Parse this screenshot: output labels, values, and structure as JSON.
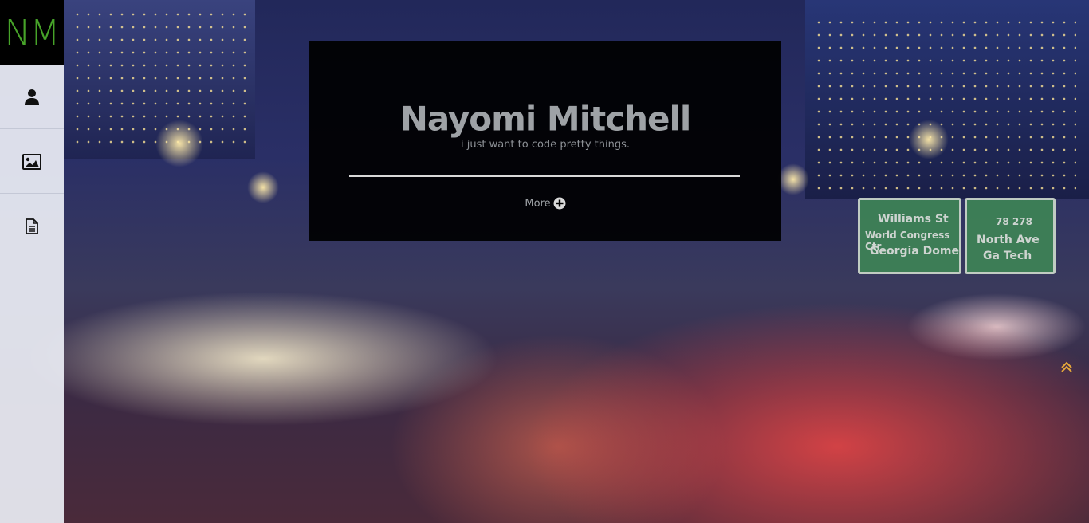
{
  "brand": {
    "logo_text": "NM",
    "accent_color": "#47a329"
  },
  "sidebar": {
    "items": [
      {
        "icon": "user-icon"
      },
      {
        "icon": "image-icon"
      },
      {
        "icon": "document-icon"
      }
    ]
  },
  "hero": {
    "name": "Nayomi Mitchell",
    "tagline": "i just want to code pretty things.",
    "more_label": "More"
  },
  "background": {
    "signs": [
      {
        "lines": [
          "Williams St",
          "World Congress Ctr",
          "Georgia Dome"
        ]
      },
      {
        "lines": [
          "78 278",
          "North Ave",
          "Ga Tech"
        ]
      }
    ]
  }
}
